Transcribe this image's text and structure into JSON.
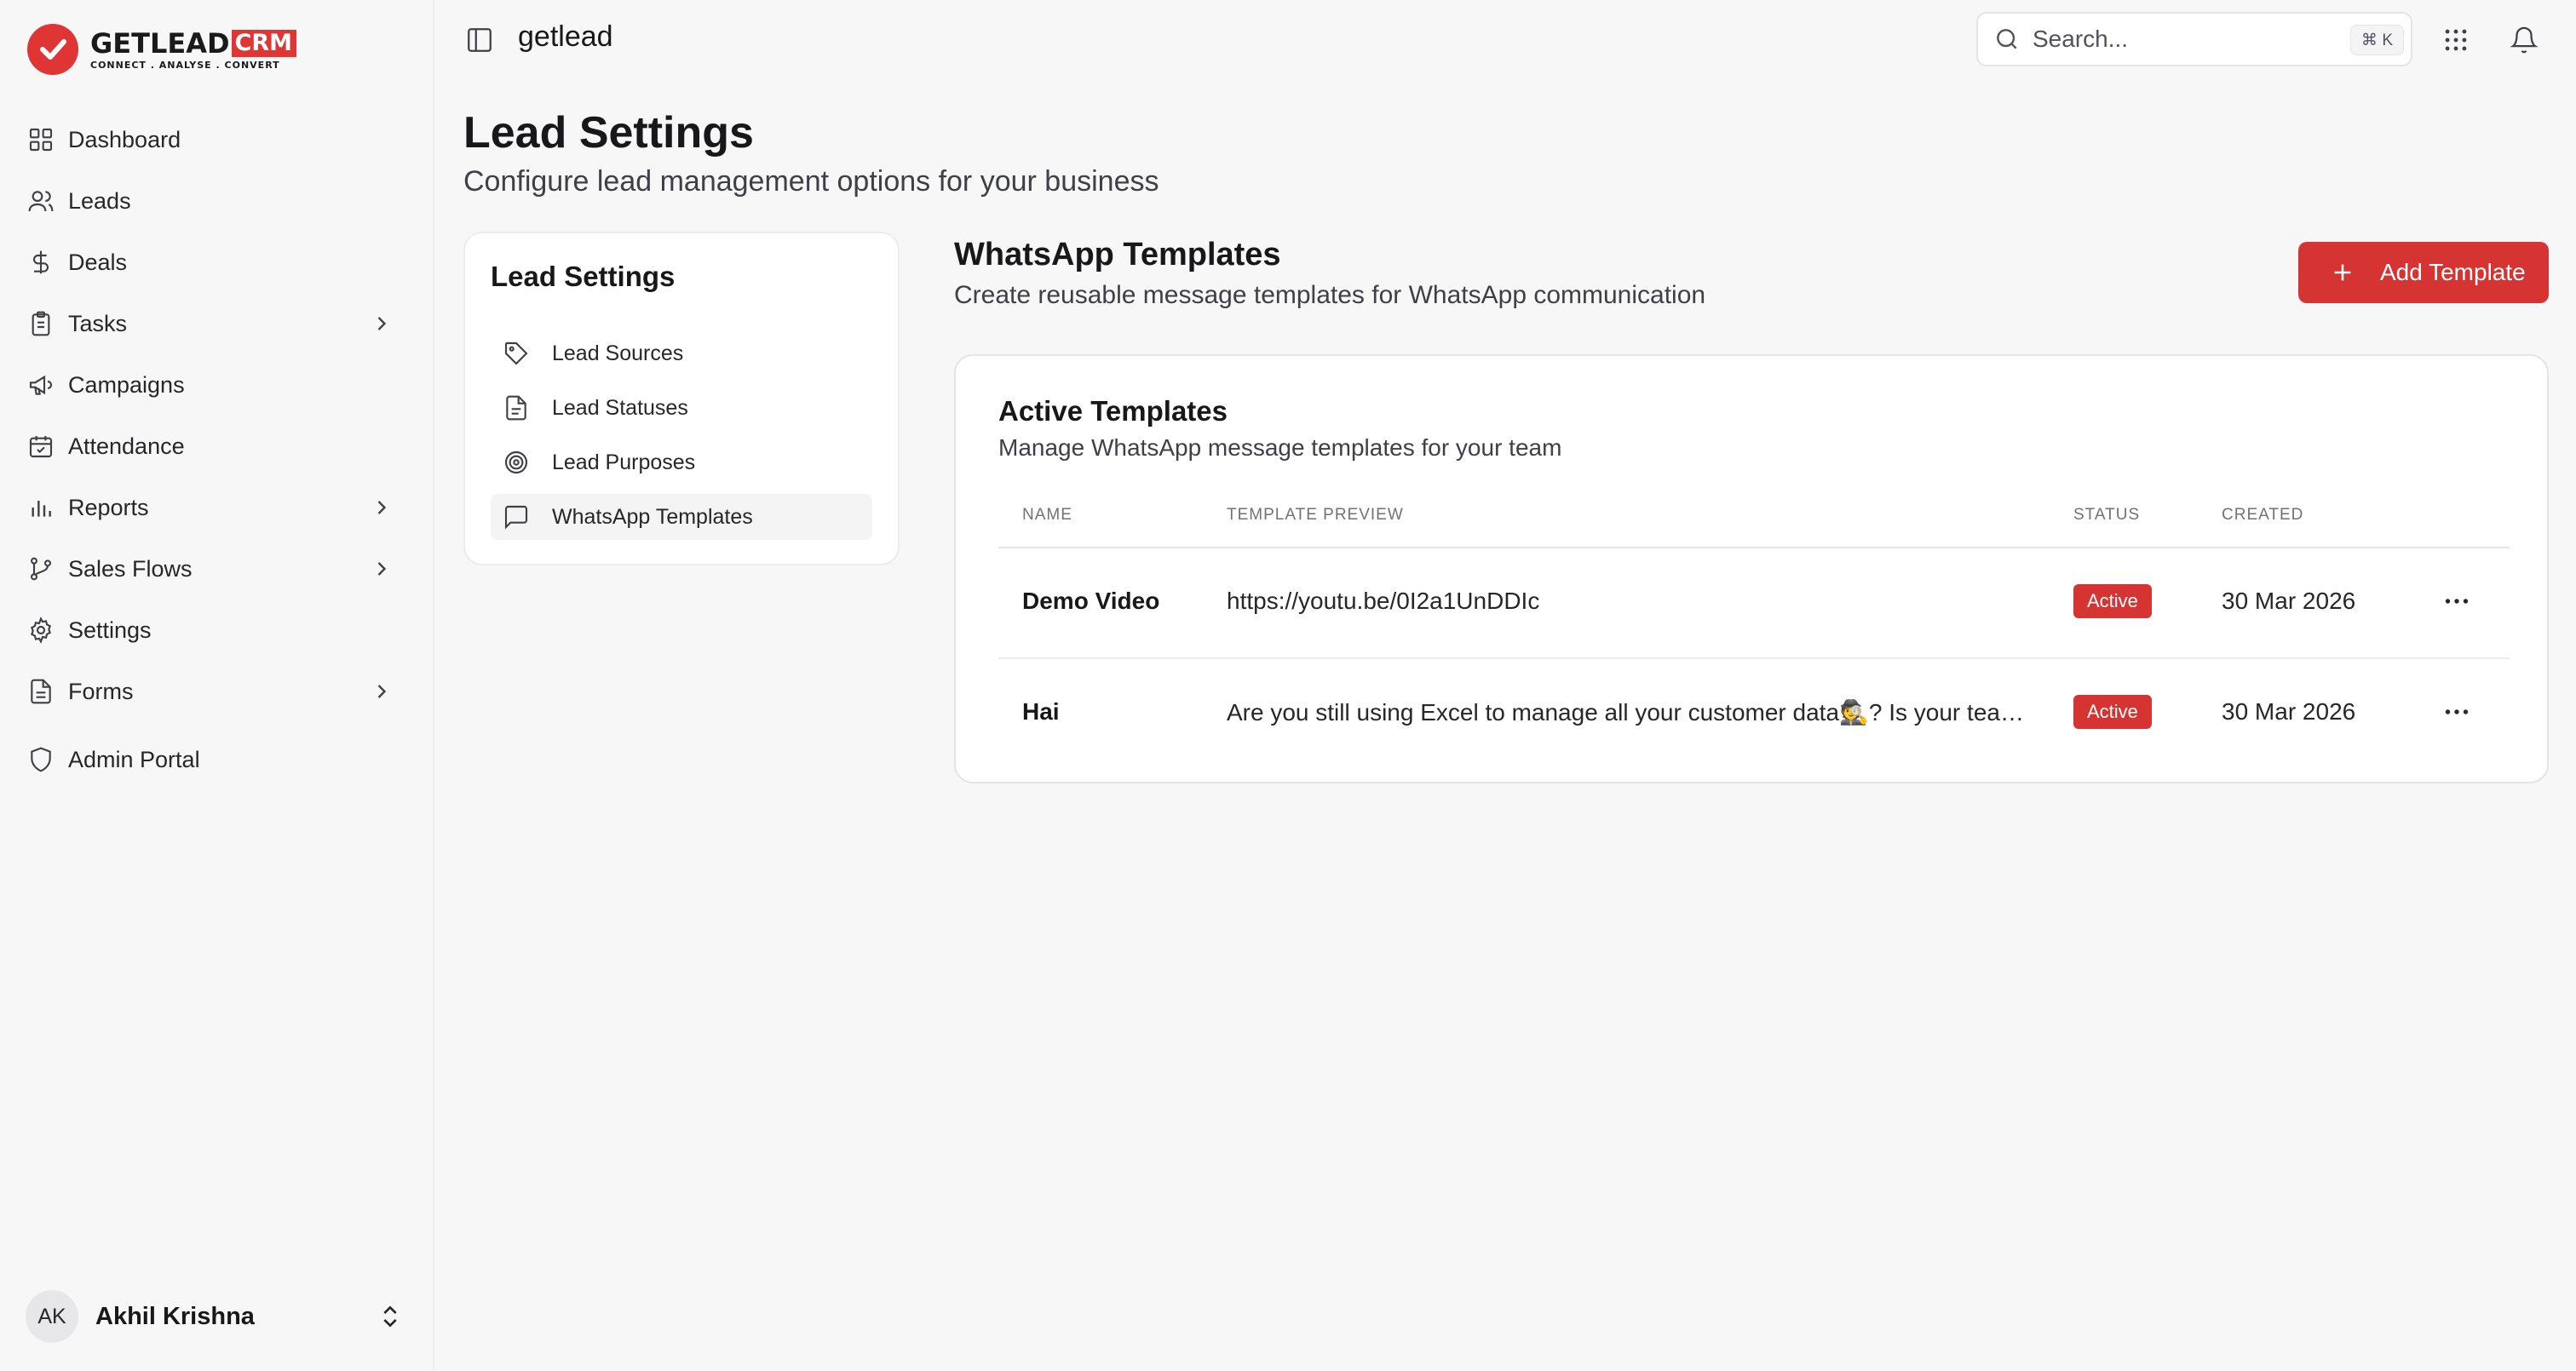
{
  "brand": {
    "logo_word": "GETLEAD",
    "logo_crm": "CRM",
    "logo_tagline": "CONNECT  .  ANALYSE  .  CONVERT",
    "accent_color": "#e03535"
  },
  "sidebar": {
    "items": [
      {
        "label": "Dashboard",
        "icon": "grid-icon",
        "has_submenu": false
      },
      {
        "label": "Leads",
        "icon": "users-icon",
        "has_submenu": false
      },
      {
        "label": "Deals",
        "icon": "dollar-icon",
        "has_submenu": false
      },
      {
        "label": "Tasks",
        "icon": "clipboard-icon",
        "has_submenu": true
      },
      {
        "label": "Campaigns",
        "icon": "megaphone-icon",
        "has_submenu": false
      },
      {
        "label": "Attendance",
        "icon": "calendar-check-icon",
        "has_submenu": false
      },
      {
        "label": "Reports",
        "icon": "bar-chart-icon",
        "has_submenu": true
      },
      {
        "label": "Sales Flows",
        "icon": "git-branch-icon",
        "has_submenu": true
      },
      {
        "label": "Settings",
        "icon": "gear-icon",
        "has_submenu": false
      },
      {
        "label": "Forms",
        "icon": "file-text-icon",
        "has_submenu": true
      },
      {
        "label": "Admin Portal",
        "icon": "shield-icon",
        "has_submenu": false
      }
    ],
    "user": {
      "initials": "AK",
      "name": "Akhil Krishna"
    }
  },
  "topbar": {
    "workspace": "getlead",
    "search_placeholder": "Search...",
    "search_shortcut": "⌘ K"
  },
  "page": {
    "title": "Lead Settings",
    "subtitle": "Configure lead management options for your business"
  },
  "settings_nav": {
    "title": "Lead Settings",
    "items": [
      {
        "label": "Lead Sources",
        "icon": "tag-icon",
        "active": false
      },
      {
        "label": "Lead Statuses",
        "icon": "file-icon",
        "active": false
      },
      {
        "label": "Lead Purposes",
        "icon": "target-icon",
        "active": false
      },
      {
        "label": "WhatsApp Templates",
        "icon": "message-square-icon",
        "active": true
      }
    ]
  },
  "whatsapp": {
    "title": "WhatsApp Templates",
    "subtitle": "Create reusable message templates for WhatsApp communication",
    "add_button": "Add Template"
  },
  "templates": {
    "title": "Active Templates",
    "subtitle": "Manage WhatsApp message templates for your team",
    "columns": [
      "NAME",
      "TEMPLATE PREVIEW",
      "STATUS",
      "CREATED"
    ],
    "rows": [
      {
        "name": "Demo Video",
        "preview": "https://youtu.be/0I2a1UnDDIc",
        "status": "Active",
        "created": "30 Mar 2026"
      },
      {
        "name": "Hai",
        "preview": "Are you still using Excel to manage all your customer data🕵️? Is your team wasting time",
        "status": "Active",
        "created": "30 Mar 2026"
      }
    ],
    "status_color": "#d63333"
  }
}
